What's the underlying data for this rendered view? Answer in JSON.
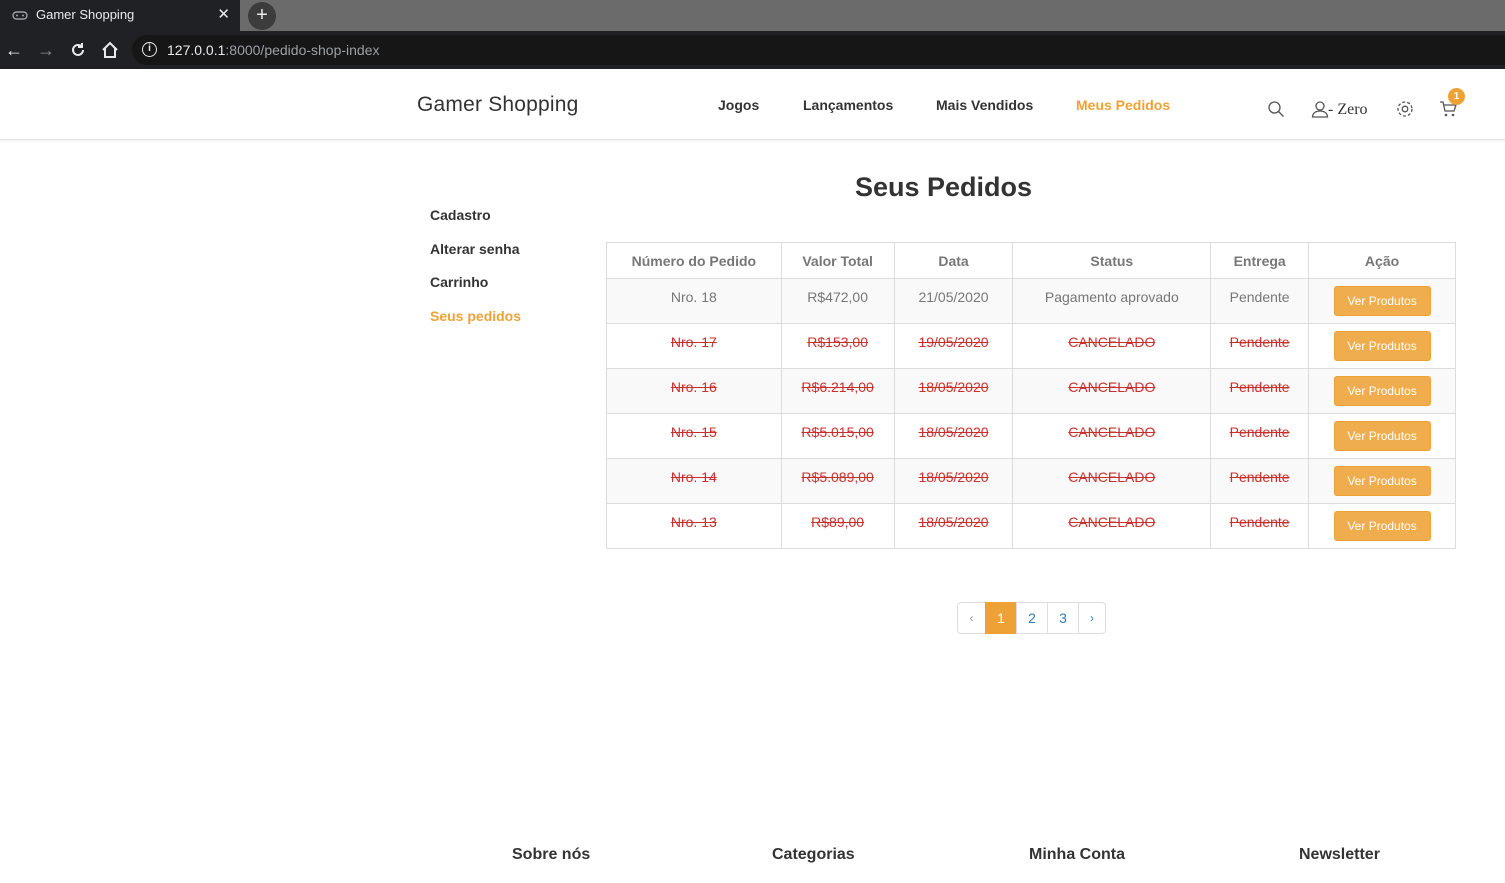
{
  "browser": {
    "tab_title": "Gamer Shopping",
    "tab_favicon": "gamepad-icon",
    "url_host": "127.0.0.1",
    "url_rest": ":8000/pedido-shop-index"
  },
  "header": {
    "brand": "Gamer Shopping",
    "nav": [
      "Jogos",
      "Lançamentos",
      "Mais Vendidos",
      "Meus Pedidos"
    ],
    "active_nav": "Meus Pedidos",
    "user_name": "- Zero",
    "cart_count": "1",
    "accent_color": "#eea236"
  },
  "sidebar": {
    "items": [
      "Cadastro",
      "Alterar senha",
      "Carrinho",
      "Seus pedidos"
    ],
    "active": "Seus pedidos"
  },
  "main": {
    "title": "Seus Pedidos",
    "columns": [
      "Número do Pedido",
      "Valor Total",
      "Data",
      "Status",
      "Entrega",
      "Ação"
    ],
    "rows": [
      {
        "numero": "Nro. 18",
        "valor": "R$472,00",
        "data": "21/05/2020",
        "status": "Pagamento aprovado",
        "entrega": "Pendente",
        "acao": "Ver Produtos",
        "cancelled": false
      },
      {
        "numero": "Nro. 17",
        "valor": "R$153,00",
        "data": "19/05/2020",
        "status": "CANCELADO",
        "entrega": "Pendente",
        "acao": "Ver Produtos",
        "cancelled": true
      },
      {
        "numero": "Nro. 16",
        "valor": "R$6.214,00",
        "data": "18/05/2020",
        "status": "CANCELADO",
        "entrega": "Pendente",
        "acao": "Ver Produtos",
        "cancelled": true
      },
      {
        "numero": "Nro. 15",
        "valor": "R$5.015,00",
        "data": "18/05/2020",
        "status": "CANCELADO",
        "entrega": "Pendente",
        "acao": "Ver Produtos",
        "cancelled": true
      },
      {
        "numero": "Nro. 14",
        "valor": "R$5.089,00",
        "data": "18/05/2020",
        "status": "CANCELADO",
        "entrega": "Pendente",
        "acao": "Ver Produtos",
        "cancelled": true
      },
      {
        "numero": "Nro. 13",
        "valor": "R$89,00",
        "data": "18/05/2020",
        "status": "CANCELADO",
        "entrega": "Pendente",
        "acao": "Ver Produtos",
        "cancelled": true
      }
    ]
  },
  "pagination": {
    "prev": "‹",
    "pages": [
      "1",
      "2",
      "3"
    ],
    "current": "1",
    "next": "›"
  },
  "footer": {
    "headings": [
      "Sobre nós",
      "Categorias",
      "Minha Conta",
      "Newsletter"
    ]
  }
}
